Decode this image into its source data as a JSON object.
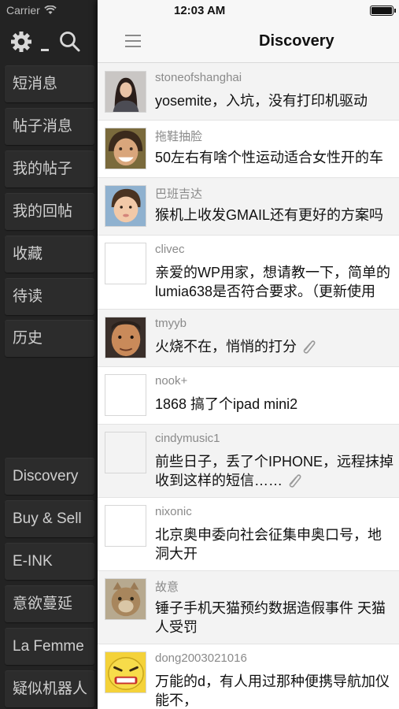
{
  "status_bar": {
    "carrier": "Carrier",
    "time": "12:03 AM"
  },
  "sidebar": {
    "tools": [
      "gear-icon",
      "minimize-icon",
      "search-icon"
    ],
    "items": [
      {
        "label": "短消息"
      },
      {
        "label": "帖子消息"
      },
      {
        "label": "我的帖子"
      },
      {
        "label": "我的回帖"
      },
      {
        "label": "收藏"
      },
      {
        "label": "待读"
      },
      {
        "label": "历史"
      }
    ],
    "boards": [
      {
        "label": "Discovery"
      },
      {
        "label": "Buy & Sell"
      },
      {
        "label": "E-INK"
      },
      {
        "label": "意欲蔓延"
      },
      {
        "label": "La Femme"
      },
      {
        "label": "疑似机器人"
      }
    ]
  },
  "header": {
    "title": "Discovery",
    "menu_icon": "hamburger-icon"
  },
  "posts": [
    {
      "user": "stoneofshanghai",
      "title": [
        "yosemite，入坑，没有打印机驱动"
      ],
      "attachment": false,
      "avatar": "photo-woman"
    },
    {
      "user": "拖鞋抽脸",
      "title": [
        "50左右有啥个性运动适合女性开的车"
      ],
      "attachment": false,
      "avatar": "photo-man-laughing"
    },
    {
      "user": "巴班吉达",
      "title": [
        "猴机上收发GMAIL还有更好的方案吗"
      ],
      "attachment": false,
      "avatar": "photo-child"
    },
    {
      "user": "clivec",
      "title": [
        "亲爱的WP用家，想请教一下，简单的",
        "lumia638是否符合要求。（更新使用"
      ],
      "attachment": false,
      "avatar": "blank"
    },
    {
      "user": "tmyyb",
      "title": [
        "火烧不在，悄悄的打分"
      ],
      "attachment": true,
      "avatar": "photo-man-face"
    },
    {
      "user": "nook+",
      "title": [
        "1868 搞了个ipad mini2"
      ],
      "attachment": false,
      "avatar": "blank"
    },
    {
      "user": "cindymusic1",
      "title": [
        "前些日子，丢了个IPHONE，远程抹掉",
        "收到这样的短信……"
      ],
      "attachment": true,
      "avatar": "blank"
    },
    {
      "user": "nixonic",
      "title": [
        "北京奥申委向社会征集申奥口号，地",
        "洞大开"
      ],
      "attachment": false,
      "avatar": "blank"
    },
    {
      "user": "故意",
      "title": [
        "锤子手机天猫预约数据造假事件 天猫",
        "人受罚"
      ],
      "attachment": false,
      "avatar": "photo-cat"
    },
    {
      "user": "dong2003021016",
      "title": [
        "万能的d，有人用过那种便携导航加仪",
        "能不，"
      ],
      "attachment": false,
      "avatar": "emoji-face"
    }
  ],
  "colors": {
    "sidebar_bg": "#232323",
    "sidebar_item_bg": "#2c2c2c",
    "row_alt": "#f3f3f3",
    "row_white": "#ffffff"
  }
}
